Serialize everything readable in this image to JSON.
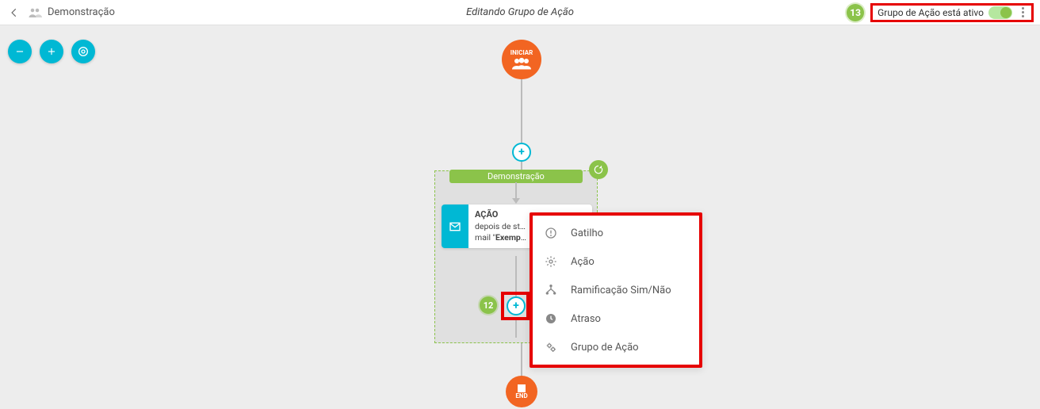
{
  "header": {
    "title_left": "Demonstração",
    "title_center": "Editando Grupo de Ação",
    "active_label": "Grupo de Ação está ativo",
    "badge_right": "13"
  },
  "annotations": {
    "add_badge": "12"
  },
  "flow": {
    "start_label": "INICIAR",
    "end_label": "END",
    "group_title": "Demonstração",
    "action_card": {
      "heading": "AÇÃO",
      "line1": "depois de st…",
      "line2_prefix": "mail \"",
      "line2_bold": "Exemp",
      "line2_suffix": "…"
    }
  },
  "context_menu": {
    "items": [
      {
        "icon": "alert-icon",
        "label": "Gatilho"
      },
      {
        "icon": "gear-icon",
        "label": "Ação"
      },
      {
        "icon": "branch-icon",
        "label": "Ramificação Sim/Não"
      },
      {
        "icon": "clock-icon",
        "label": "Atraso"
      },
      {
        "icon": "gears-icon",
        "label": "Grupo de Ação"
      }
    ]
  }
}
